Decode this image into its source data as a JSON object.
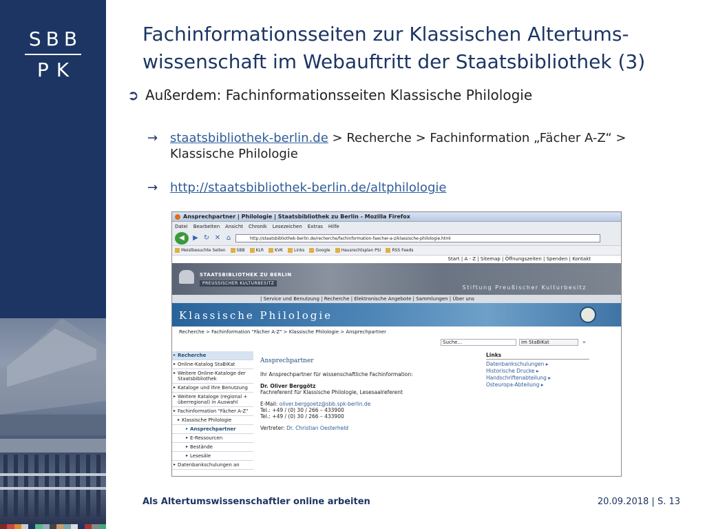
{
  "logo": {
    "top": "SBB",
    "bottom": "PK"
  },
  "title": "Fachinformationsseiten zur Klassischen Altertums-wissenschaft im Webauftritt der Staatsbibliothek (3)",
  "bullet": "Außerdem: Fachinformationsseiten Klassische Philologie",
  "sub1": {
    "link": "staatsbibliothek-berlin.de",
    "rest": " > Recherche > Fachinformation „Fächer A-Z“ > Klassische Philologie"
  },
  "sub2": {
    "link": "http://staatsbibliothek-berlin.de/altphilologie"
  },
  "browser": {
    "title": "Ansprechpartner | Philologie | Staatsbibliothek zu Berlin - Mozilla Firefox",
    "menu": [
      "Datei",
      "Bearbeiten",
      "Ansicht",
      "Chronik",
      "Lesezeichen",
      "Extras",
      "Hilfe"
    ],
    "url": "http://staatsbibliothek-berlin.de/recherche/fachinformation-faecher-a-z/klassische-philologie.html",
    "bookmarks": [
      "Meistbesuchte Seiten",
      "SBB",
      "KLR",
      "KVK",
      "Links",
      "Google",
      "Hausrechtsplan PSI",
      "RSS Feeds"
    ]
  },
  "site": {
    "toplinks": "Start | A - Z | Sitemap | Öffnungszeiten | Spenden | Kontakt",
    "name1": "STAATSBIBLIOTHEK ZU BERLIN",
    "name2": "PREUSSISCHER KULTURBESITZ",
    "stiftung": "Stiftung Preußischer Kulturbesitz",
    "nav": "| Service und Benutzung | Recherche | Elektronische Angebote | Sammlungen | Über uns",
    "section": "Klassische Philologie",
    "breadcrumb": "Recherche > Fachinformation \"Fächer A-Z\" > Klassische Philologie > Ansprechpartner",
    "search_placeholder": "Suche...",
    "search_scope": "im StaBiKat",
    "search_go": "»",
    "leftnav": [
      "Recherche",
      "Online-Katalog StaBiKat",
      "Weitere Online-Kataloge der Staatsbibliothek",
      "Kataloge und ihre Benutzung",
      "Weitere Kataloge (regional + überregional) in Auswahl",
      "Fachinformation \"Fächer A-Z\"",
      "Klassische Philologie",
      "Ansprechpartner",
      "E-Ressourcen",
      "Bestände",
      "Lesesäle",
      "Datenbankschulungen an"
    ],
    "main": {
      "heading": "Ansprechpartner",
      "intro": "Ihr Ansprechpartner für wissenschaftliche Fachinformation:",
      "name": "Dr. Oliver Berggötz",
      "role": "Fachreferent für Klassische Philologie, Lesesaalreferent",
      "email_label": "E-Mail:",
      "email": "oliver.berggoetz@sbb.spk-berlin.de",
      "tel1": "Tel.: +49 / (0) 30 / 266 – 433900",
      "tel2": "Tel.: +49 / (0) 30 / 266 – 433900",
      "deputy_label": "Vertreter:",
      "deputy": "Dr. Christian Oesterheld"
    },
    "links": {
      "heading": "Links",
      "items": [
        "Datenbankschulungen",
        "Historische Drucke",
        "Handschriftenabteilung",
        "Osteuropa-Abteilung"
      ]
    }
  },
  "footer": {
    "left": "Als Altertumswissenschaftler online arbeiten",
    "date": "20.09.2018",
    "sep": " | ",
    "page": "S. 13"
  },
  "colors": {
    "navy": "#1c3563",
    "link": "#2f5c9a",
    "colorbar": [
      "#7a2a2a",
      "#c44",
      "#d88a2e",
      "#ccc",
      "#1c3563",
      "#5b8",
      "#9ab",
      "#444",
      "#c96",
      "#7aa",
      "#ddd",
      "#236",
      "#a33",
      "#888",
      "#4a7"
    ]
  }
}
